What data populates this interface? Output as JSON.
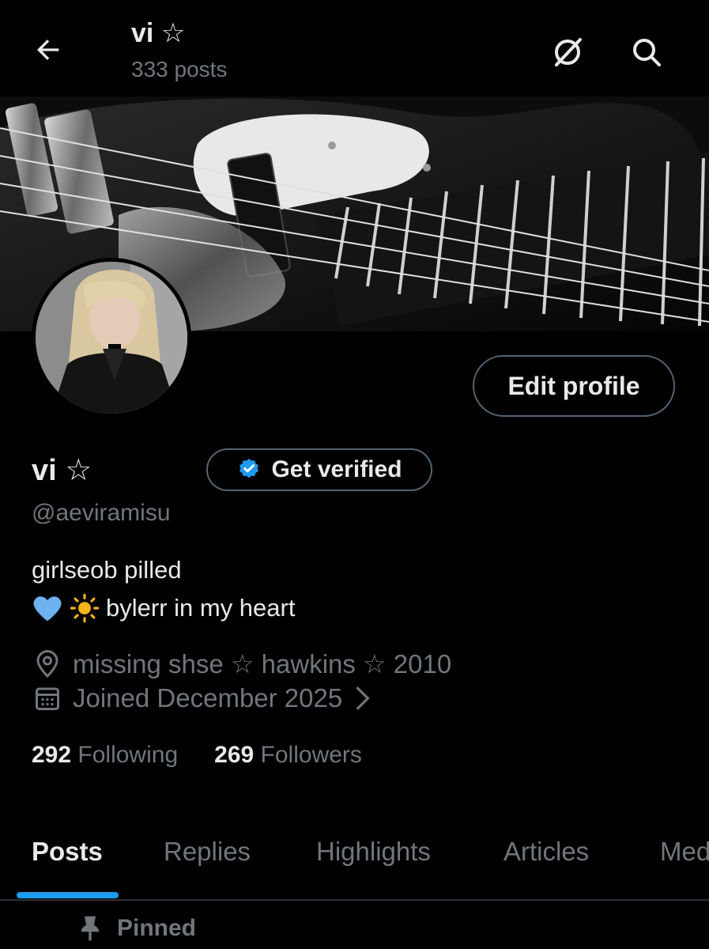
{
  "header": {
    "title": "vi ☆",
    "post_count": "333 posts",
    "back_icon": "arrow-left-icon",
    "grok_icon": "grok-icon",
    "search_icon": "search-icon"
  },
  "profile": {
    "display_name": "vi ☆",
    "handle": "@aeviramisu",
    "edit_button": "Edit profile",
    "get_verified": "Get verified",
    "bio_line1": "girlseob pilled",
    "bio_line2": "bylerr in my heart",
    "bio_emoji": [
      "blue-heart",
      "sun"
    ],
    "location": "missing shse ☆ hawkins ☆ 2010",
    "joined": "Joined December 2025",
    "following_count": "292",
    "following_label": "Following",
    "followers_count": "269",
    "followers_label": "Followers"
  },
  "tabs": [
    {
      "label": "Posts",
      "active": true
    },
    {
      "label": "Replies",
      "active": false
    },
    {
      "label": "Highlights",
      "active": false
    },
    {
      "label": "Articles",
      "active": false
    },
    {
      "label": "Media",
      "active": false
    }
  ],
  "pinned_label": "Pinned",
  "colors": {
    "background": "#000000",
    "text_primary": "#e7e9ea",
    "text_secondary": "#71767b",
    "accent": "#1d9bf0",
    "border": "#536471"
  }
}
